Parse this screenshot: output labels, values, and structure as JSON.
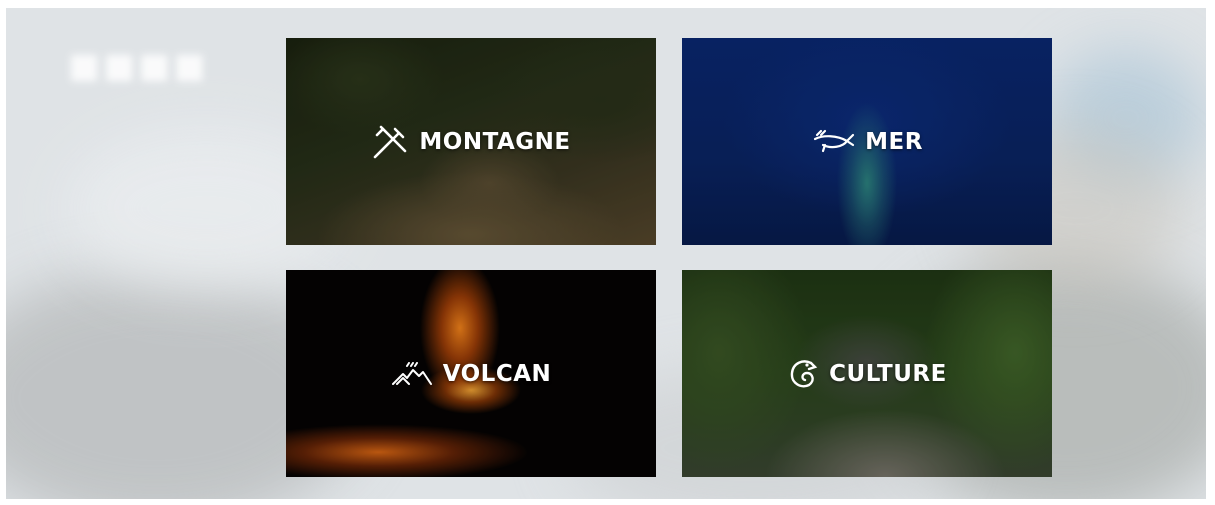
{
  "categories": [
    {
      "id": "montagne",
      "label": "MONTAGNE",
      "icon": "hiking-poles-icon"
    },
    {
      "id": "mer",
      "label": "MER",
      "icon": "whale-icon"
    },
    {
      "id": "volcan",
      "label": "VOLCAN",
      "icon": "volcano-icon"
    },
    {
      "id": "culture",
      "label": "CULTURE",
      "icon": "chameleon-icon"
    }
  ]
}
